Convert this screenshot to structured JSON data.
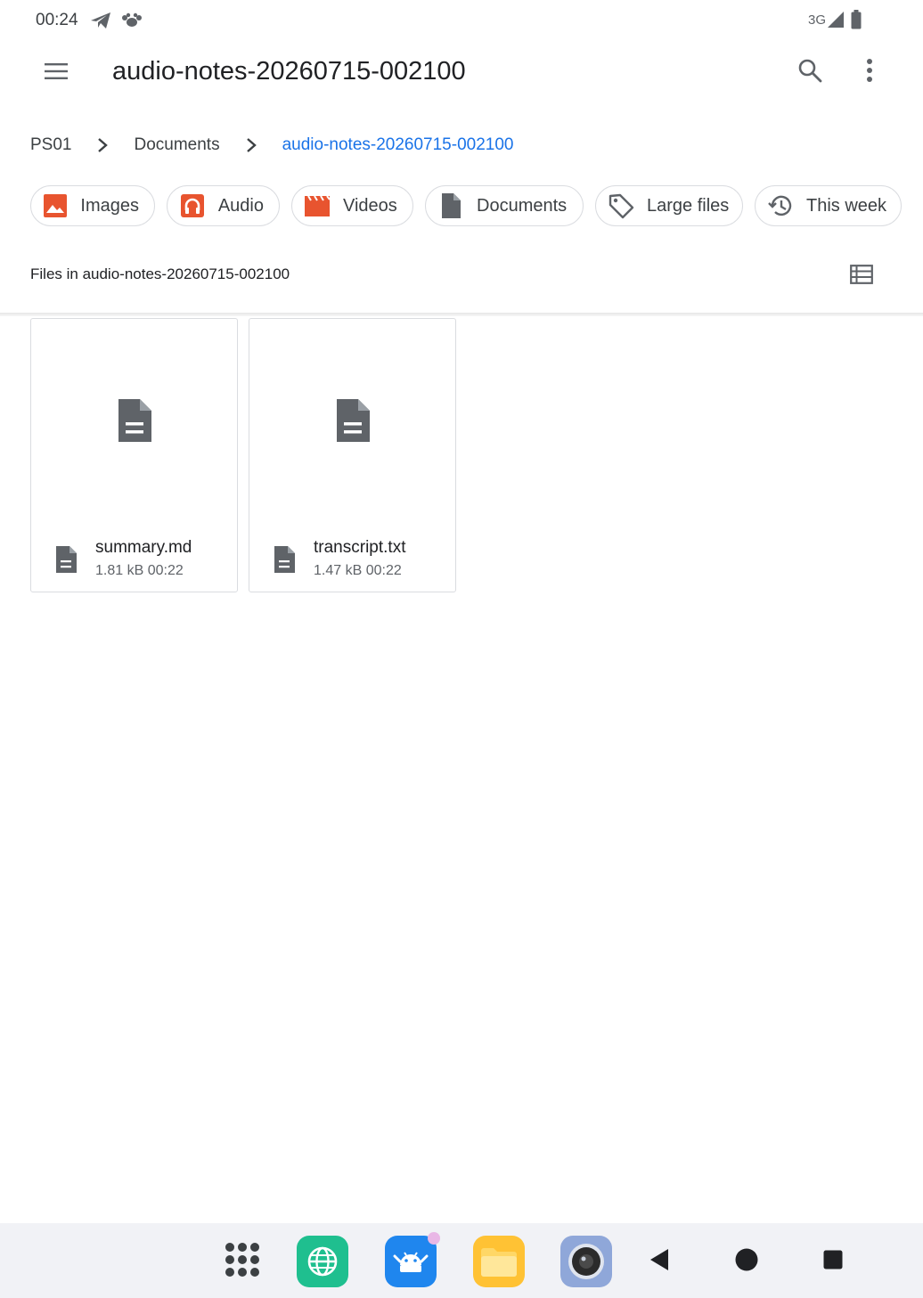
{
  "status_bar": {
    "time": "00:24",
    "network": "3G",
    "icons": [
      "telegram-icon",
      "paw-icon",
      "signal-icon",
      "battery-icon"
    ]
  },
  "app_bar": {
    "title": "audio-notes-20260715-002100",
    "icons": [
      "menu-icon",
      "search-icon",
      "more-vert-icon"
    ]
  },
  "breadcrumb": [
    {
      "label": "PS01"
    },
    {
      "label": "Documents"
    },
    {
      "label": "audio-notes-20260715-002100"
    }
  ],
  "colors": {
    "accent": "#1a73e8",
    "images_chip": "#e8542f",
    "audio_chip": "#e8542f",
    "videos_chip": "#e8542f",
    "documents_chip": "#5f6368",
    "file_icon": "#5f6368"
  },
  "filter_chips": [
    {
      "label": "Images",
      "icon": "image-icon"
    },
    {
      "label": "Audio",
      "icon": "headphones-icon"
    },
    {
      "label": "Videos",
      "icon": "clapperboard-icon"
    },
    {
      "label": "Documents",
      "icon": "document-icon"
    },
    {
      "label": "Large files",
      "icon": "tag-icon"
    },
    {
      "label": "This week",
      "icon": "history-icon"
    }
  ],
  "section": {
    "label": "Files in audio-notes-20260715-002100",
    "view_toggle_icon": "list-view-icon"
  },
  "files": [
    {
      "name": "summary.md",
      "info": "1.81 kB 00:22",
      "icon": "document-icon"
    },
    {
      "name": "transcript.txt",
      "info": "1.47 kB 00:22",
      "icon": "document-icon"
    }
  ],
  "taskbar": {
    "apps": [
      {
        "name": "app-drawer",
        "icon": "grid-dots-icon"
      },
      {
        "name": "browser",
        "icon": "globe-icon",
        "color": "#1fbf8f"
      },
      {
        "name": "android-app",
        "icon": "android-icon",
        "color": "#1f86ee"
      },
      {
        "name": "files",
        "icon": "folder-icon",
        "color": "#ffc234"
      },
      {
        "name": "camera",
        "icon": "camera-icon",
        "color": "#8fa7d9"
      }
    ],
    "nav": [
      "back-icon",
      "home-icon",
      "recents-icon"
    ]
  }
}
